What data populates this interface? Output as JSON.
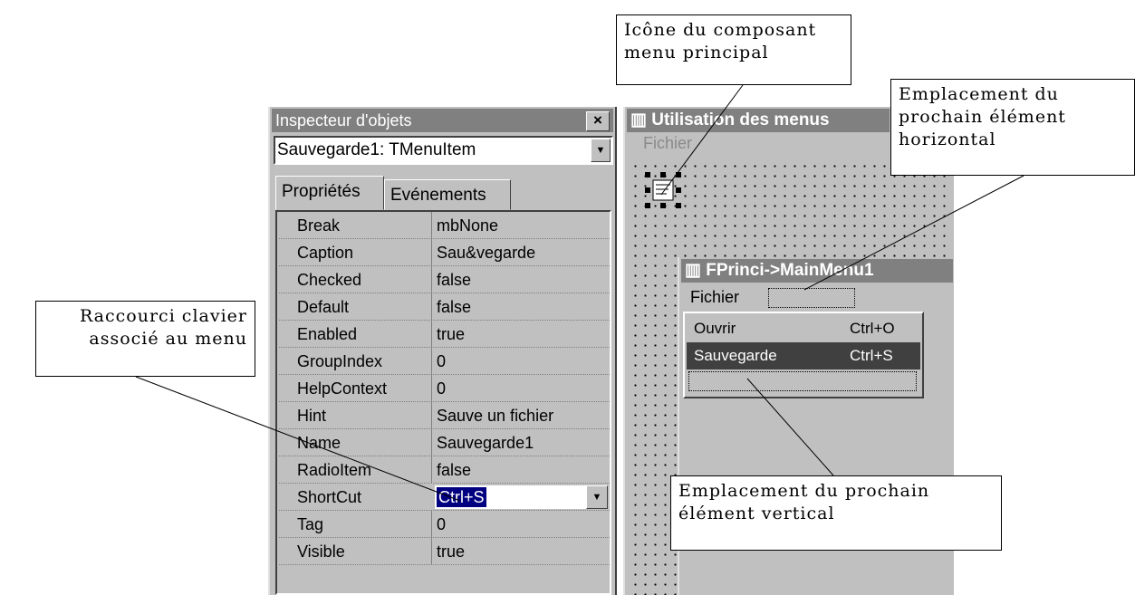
{
  "inspector": {
    "title": "Inspecteur d'objets",
    "close_label": "×",
    "object_selector": "Sauvegarde1: TMenuItem",
    "tabs": [
      "Propriétés",
      "Evénements"
    ],
    "properties": [
      {
        "name": "Break",
        "value": "mbNone"
      },
      {
        "name": "Caption",
        "value": "Sau&vegarde"
      },
      {
        "name": "Checked",
        "value": "false"
      },
      {
        "name": "Default",
        "value": "false"
      },
      {
        "name": "Enabled",
        "value": "true"
      },
      {
        "name": "GroupIndex",
        "value": "0"
      },
      {
        "name": "HelpContext",
        "value": "0"
      },
      {
        "name": "Hint",
        "value": "Sauve un fichier"
      },
      {
        "name": "Name",
        "value": "Sauvegarde1"
      },
      {
        "name": "RadioItem",
        "value": "false"
      },
      {
        "name": "ShortCut",
        "value": "Ctrl+S"
      },
      {
        "name": "Tag",
        "value": "0"
      },
      {
        "name": "Visible",
        "value": "true"
      }
    ]
  },
  "form": {
    "title": "Utilisation des menus",
    "menu_label": "Fichier"
  },
  "designer": {
    "title": "FPrinci->MainMenu1",
    "menu_label": "Fichier",
    "items": [
      {
        "label": "Ouvrir",
        "shortcut": "Ctrl+O"
      },
      {
        "label": "Sauvegarde",
        "shortcut": "Ctrl+S"
      }
    ]
  },
  "callouts": {
    "icon": [
      "Icône du composant",
      "menu principal"
    ],
    "horizontal": [
      "Emplacement du",
      "prochain élément",
      "horizontal"
    ],
    "shortcut": [
      "Raccourci clavier",
      "associé au menu"
    ],
    "vertical": [
      "Emplacement du prochain",
      "élément vertical"
    ]
  }
}
